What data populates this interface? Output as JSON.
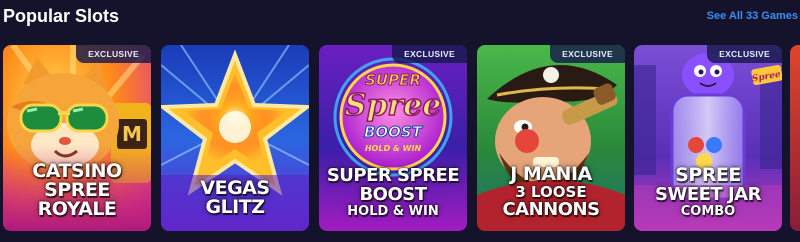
{
  "header": {
    "title": "Popular Slots",
    "see_all": "See All 33 Games"
  },
  "colors": {
    "background": "#14132b",
    "link": "#3f8cf4",
    "badge_bg": "#161a4c"
  },
  "games": [
    {
      "badge": "EXCLUSIVE",
      "lines": [
        "CATSINO",
        "SPREE",
        "ROYALE"
      ]
    },
    {
      "badge": "",
      "lines": [
        "VEGAS",
        "GLITZ"
      ]
    },
    {
      "badge": "EXCLUSIVE",
      "logo_lines": [
        "SUPER",
        "Spree",
        "BOOST",
        "HOLD & WIN"
      ],
      "lines": [
        "SUPER SPREE",
        "BOOST",
        "HOLD & WIN"
      ]
    },
    {
      "badge": "EXCLUSIVE",
      "lines": [
        "J MANIA",
        "3 LOOSE",
        "CANNONS"
      ]
    },
    {
      "badge": "EXCLUSIVE",
      "logo_lines": [
        "Spree"
      ],
      "lines": [
        "SPREE",
        "SWEET JAR",
        "COMBO"
      ]
    }
  ]
}
